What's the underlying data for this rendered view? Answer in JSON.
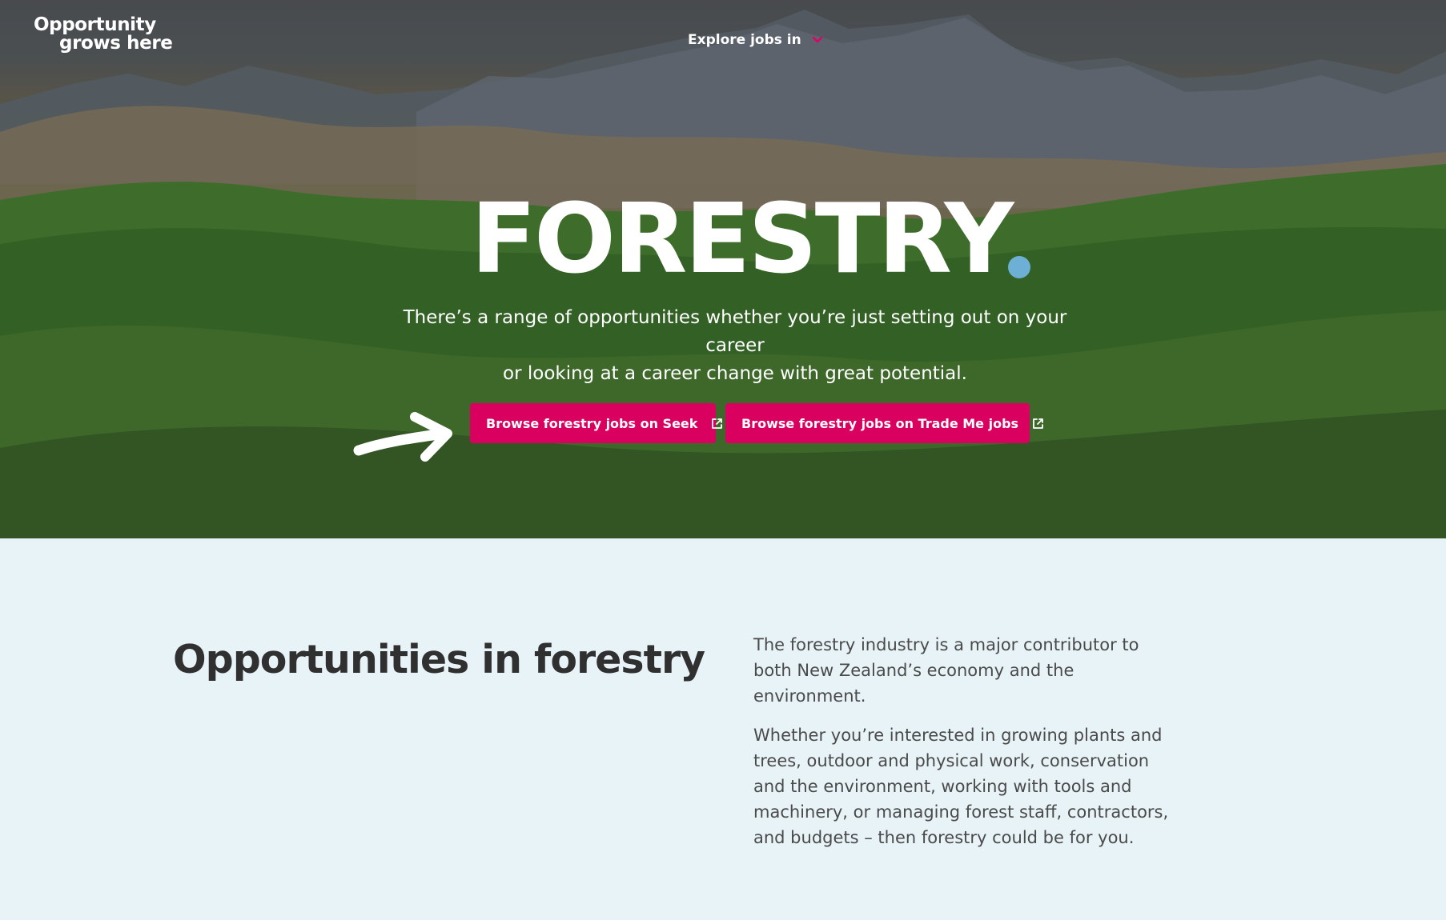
{
  "header": {
    "logo_line_1": "Opportunity",
    "logo_line_2": "grows here",
    "nav_label": "Explore jobs in",
    "nav_icon": "chevron-down-icon"
  },
  "hero": {
    "title": "FORESTRY",
    "subtitle_line_1": "There’s a range of opportunities whether you’re just setting out on your career",
    "subtitle_line_2": "or looking at a career change with great potential.",
    "arrow_icon": "arrow-right-icon",
    "buttons": [
      {
        "label": "Browse forestry jobs on Seek",
        "icon": "external-link-icon"
      },
      {
        "label": "Browse forestry jobs on Trade Me jobs",
        "icon": "external-link-icon"
      }
    ]
  },
  "section": {
    "title": "Opportunities in forestry",
    "paragraphs": [
      "The forestry industry is a major contributor to both New Zealand’s economy and the environment.",
      "Whether you’re interested in growing plants and trees, outdoor and physical work, conservation and the environment, working with tools and machinery, or managing forest staff, contractors, and budgets – then forestry could be for you."
    ]
  },
  "colors": {
    "accent": "#d9005f",
    "title_dot": "#6dafd5",
    "hero_text": "#ffffff",
    "content_background": "#e8f3f8",
    "heading_text": "#303030",
    "body_text": "#4a4a4a"
  }
}
